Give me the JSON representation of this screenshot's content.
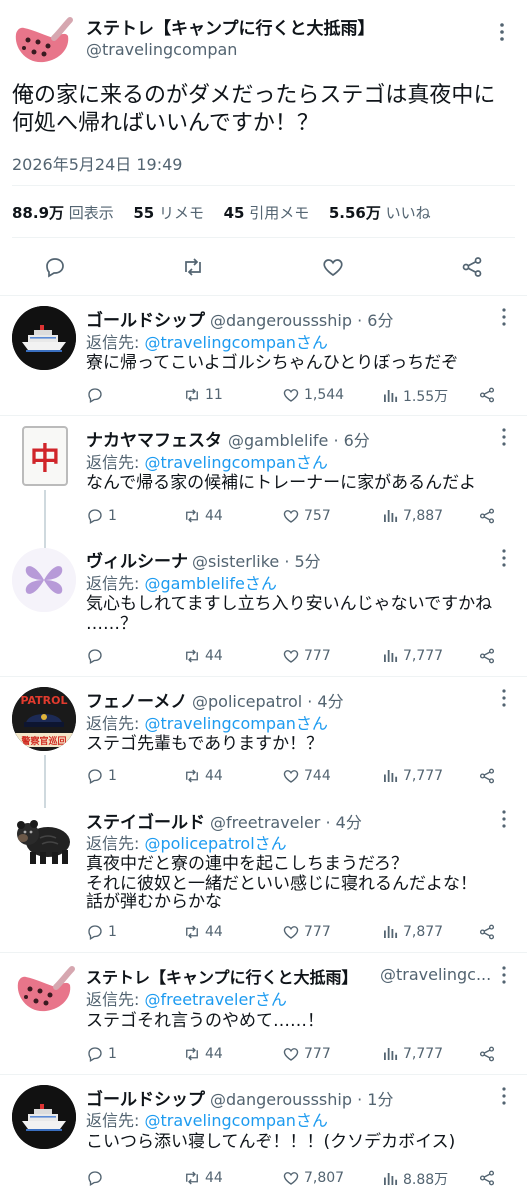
{
  "main": {
    "name": "ステトレ【キャンプに行くと大抵雨】",
    "handle": "@travelingcompan",
    "text": "俺の家に来るのがダメだったらステゴは真夜中に何処へ帰ればいいんですか！？",
    "timestamp": "2026年5月24日 19:49",
    "stats": {
      "views_value": "88.9万",
      "views_label": "回表示",
      "reposts_value": "55",
      "reposts_label": "リメモ",
      "quotes_value": "45",
      "quotes_label": "引用メモ",
      "likes_value": "5.56万",
      "likes_label": "いいね"
    }
  },
  "replies": [
    {
      "name": "ゴールドシップ",
      "handle": "@dangeroussship · 6分",
      "reply_prefix": "返信先: ",
      "reply_to": "@travelingcompanさん",
      "text": "寮に帰ってこいよゴルシちゃんひとりぼっちだぞ",
      "replies": "",
      "reposts": "11",
      "likes": "1,544",
      "views": "1.55万"
    },
    {
      "name": "ナカヤマフェスタ",
      "handle": "@gamblelife · 6分",
      "reply_prefix": "返信先: ",
      "reply_to": "@travelingcompanさん",
      "text": "なんで帰る家の候補にトレーナーに家があるんだよ",
      "replies": "1",
      "reposts": "44",
      "likes": "757",
      "views": "7,887"
    },
    {
      "name": "ヴィルシーナ",
      "handle": "@sisterlike · 5分",
      "reply_prefix": "返信先: ",
      "reply_to": "@gamblelifeさん",
      "text_line1": "気心もしれてますし立ち入り安いんじゃないですかね",
      "text_line2": "……？",
      "replies": "",
      "reposts": "44",
      "likes": "777",
      "views": "7,777"
    },
    {
      "name": "フェノーメノ",
      "handle": "@policepatrol · 4分",
      "reply_prefix": "返信先: ",
      "reply_to": "@travelingcompanさん",
      "text": "ステゴ先輩もでありますか！？",
      "replies": "1",
      "reposts": "44",
      "likes": "744",
      "views": "7,777"
    },
    {
      "name": "ステイゴールド",
      "handle": "@freetraveler · 4分",
      "reply_prefix": "返信先: ",
      "reply_to": "@policepatrolさん",
      "text_line1": "真夜中だと寮の連中を起こしちまうだろ？",
      "text_line2": "それに彼奴と一緒だといい感じに寝れるんだよな！",
      "text_line3": "話が弾むからかな",
      "replies": "1",
      "reposts": "44",
      "likes": "777",
      "views": "7,877"
    },
    {
      "name": "ステトレ【キャンプに行くと大抵雨】",
      "handle": "@travelingc...",
      "reply_prefix": "返信先: ",
      "reply_to": "@freetravelerさん",
      "text": "ステゴそれ言うのやめて……！",
      "replies": "1",
      "reposts": "44",
      "likes": "777",
      "views": "7,777"
    },
    {
      "name": "ゴールドシップ",
      "handle": "@dangeroussship · 1分",
      "reply_prefix": "返信先: ",
      "reply_to": "@travelingcompanさん",
      "text": "こいつら添い寝してんぞ！！！(クソデカボイス)",
      "replies": "",
      "reposts": "44",
      "likes": "7,807",
      "views": "8.88万"
    }
  ],
  "avatars": {
    "patrol_top": "PATROL",
    "patrol_bottom": "警察官巡回",
    "mahjong_tile": "中"
  },
  "colors": {
    "accent": "#1d9bf0",
    "muted": "#536471",
    "ocarina": "#e8758a"
  }
}
